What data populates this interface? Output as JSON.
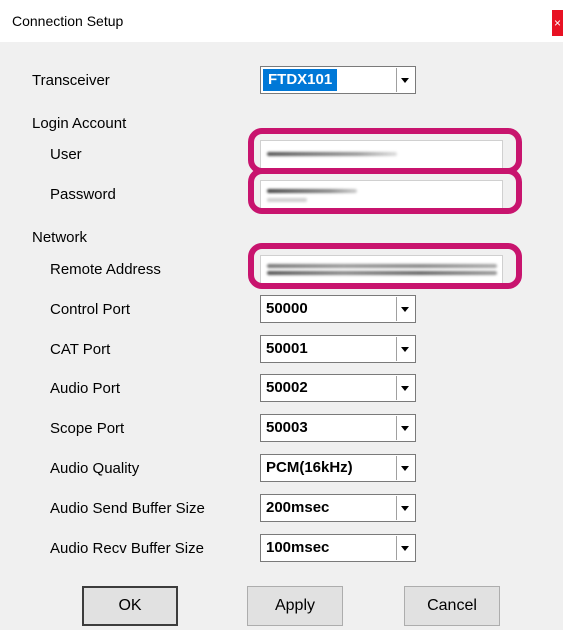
{
  "window": {
    "title": "Connection Setup",
    "close_glyph": "×"
  },
  "transceiver": {
    "label": "Transceiver",
    "value": "FTDX101"
  },
  "login": {
    "section_label": "Login Account",
    "user_label": "User",
    "password_label": "Password"
  },
  "network": {
    "section_label": "Network",
    "remote_address_label": "Remote Address",
    "control_port": {
      "label": "Control Port",
      "value": "50000"
    },
    "cat_port": {
      "label": "CAT Port",
      "value": "50001"
    },
    "audio_port": {
      "label": "Audio Port",
      "value": "50002"
    },
    "scope_port": {
      "label": "Scope Port",
      "value": "50003"
    },
    "audio_quality": {
      "label": "Audio Quality",
      "value": "PCM(16kHz)"
    },
    "audio_send_buffer": {
      "label": "Audio Send Buffer Size",
      "value": "200msec"
    },
    "audio_recv_buffer": {
      "label": "Audio Recv Buffer Size",
      "value": "100msec"
    }
  },
  "buttons": {
    "ok": "OK",
    "apply": "Apply",
    "cancel": "Cancel"
  },
  "colors": {
    "highlight": "#c8146e",
    "selection": "#0078d7"
  }
}
